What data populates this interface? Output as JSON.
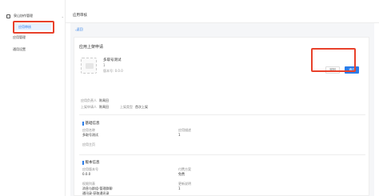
{
  "sidebar": {
    "header": "泉山协作管理",
    "items": [
      {
        "label": "应用审核"
      },
      {
        "label": "应用管理"
      },
      {
        "label": "通用设置"
      }
    ]
  },
  "topbar": {
    "title": "应用审核"
  },
  "main": {
    "back_label": "返回",
    "card_title": "应用上架申请",
    "app": {
      "name": "多取号测试",
      "subtitle": "1",
      "version": "版本号: 0.0.0"
    },
    "buttons": {
      "reject": "驳回",
      "approve": "通过"
    },
    "meta": {
      "owner_label": "应用负责人",
      "owner_value": "陈禹田",
      "applicant_label": "上架申请人",
      "applicant_value": "陈禹田",
      "type_label": "上架类型",
      "type_value": "首次上架"
    },
    "basic_section": {
      "title": "基础信息",
      "fields": [
        {
          "key": "应用名称",
          "value": "多取号测试"
        },
        {
          "key": "应用描述",
          "value": "1"
        },
        {
          "key": "应用主页",
          "value": ""
        }
      ]
    },
    "version_section": {
      "title": "版本信息",
      "fields": [
        {
          "key": "应用版本号",
          "value": "0.0.0"
        },
        {
          "key": "付费方案",
          "value": "免费"
        },
        {
          "key": "权限清单",
          "value": "消息与群组-管理群聊"
        },
        {
          "key": "权限清单2",
          "value": "通讯录-获取通讯录"
        },
        {
          "key": "更新说明",
          "value": "1"
        }
      ]
    }
  }
}
